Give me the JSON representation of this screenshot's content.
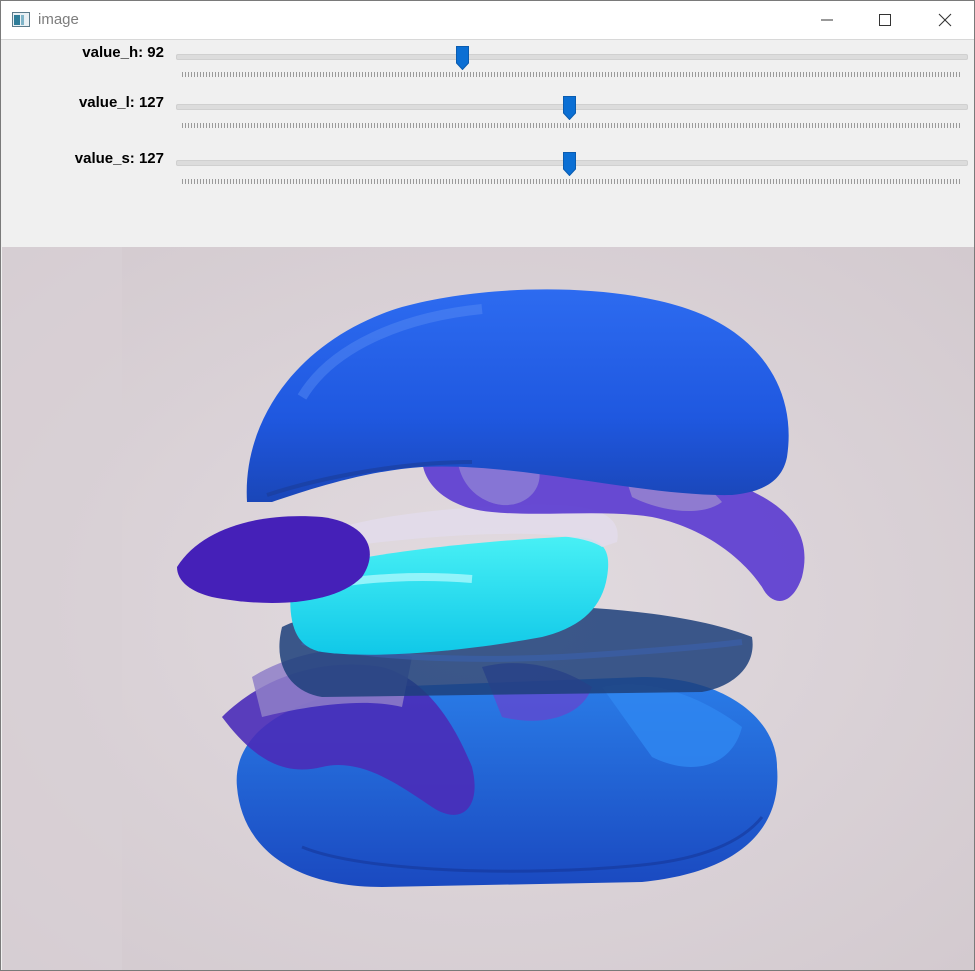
{
  "window": {
    "title": "image",
    "icons": [
      "app-icon",
      "minimize-icon",
      "maximize-icon",
      "close-icon"
    ]
  },
  "trackbars": [
    {
      "name": "value_h",
      "label": "value_h: 92",
      "value": 92,
      "max": 255
    },
    {
      "name": "value_l",
      "label": "value_l: 127",
      "value": 127,
      "max": 255
    },
    {
      "name": "value_s",
      "label": "value_s: 127",
      "value": 127,
      "max": 255
    }
  ],
  "colors": {
    "thumb": "#0b6fd4",
    "background": "#ddd6da",
    "bun": "#1f5fe8",
    "glow": "#18e6f2",
    "purple": "#5a2bd0"
  }
}
